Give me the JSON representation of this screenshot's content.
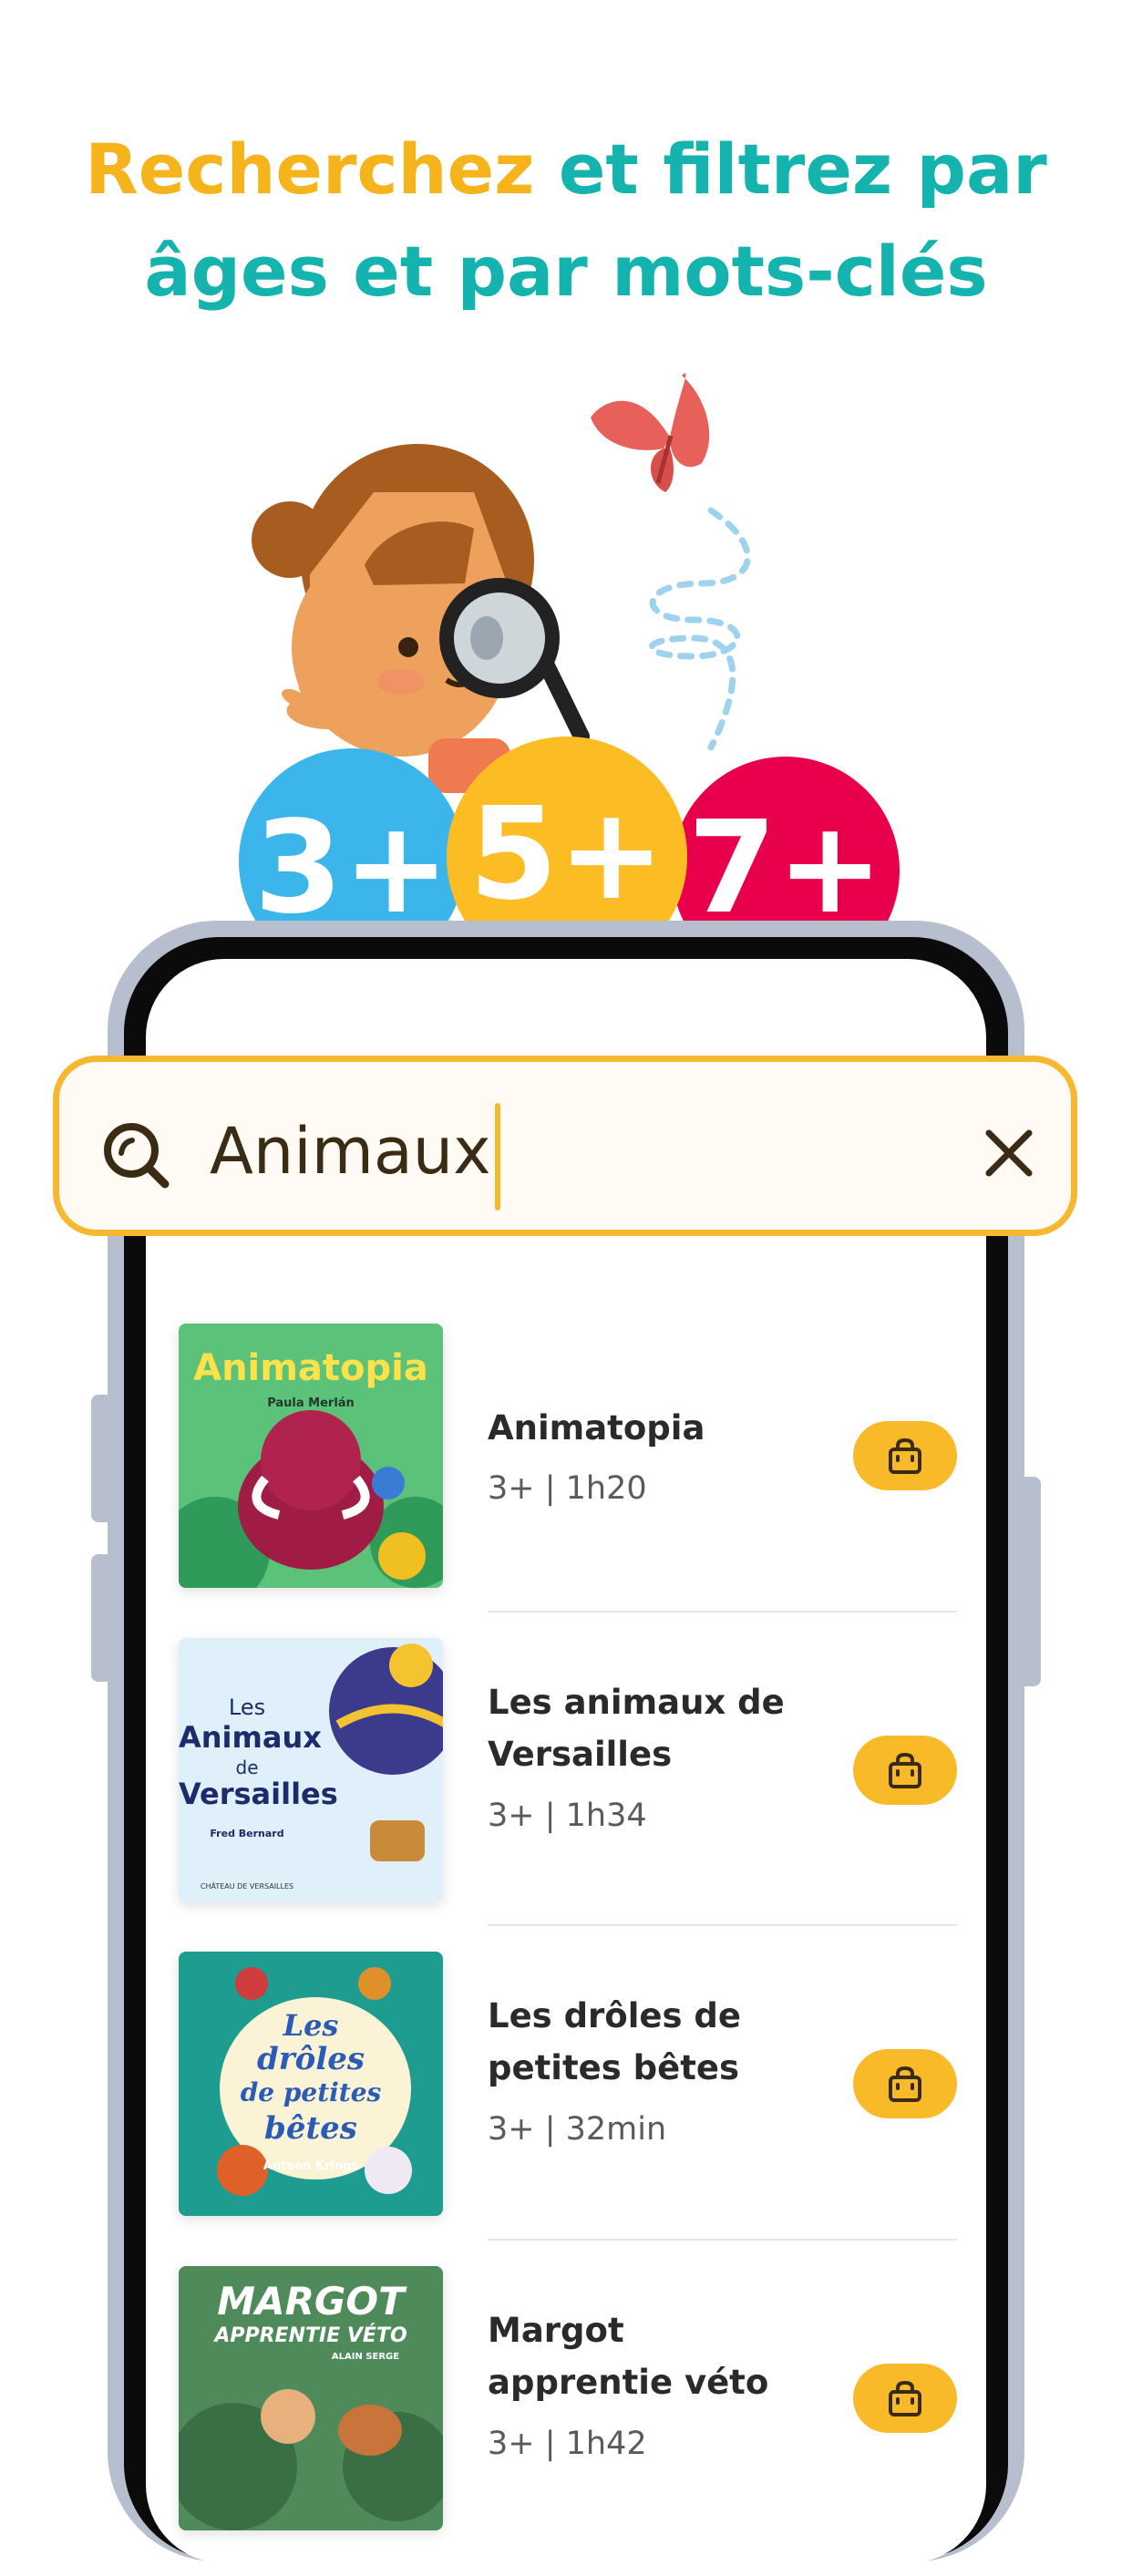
{
  "headline": {
    "part1": "Recherchez",
    "part2": " et filtrez par",
    "line2": "âges et par mots-clés"
  },
  "age_badges": [
    "3+",
    "5+",
    "7+"
  ],
  "search": {
    "query": "Animaux"
  },
  "results": [
    {
      "title": "Animatopia",
      "meta": "3+ | 1h20",
      "cover_title": "Animatopia",
      "cover_author": "Paula Merlán"
    },
    {
      "title": "Les animaux de Versailles",
      "meta": "3+ | 1h34",
      "cover_title_1": "Les",
      "cover_title_2": "Animaux",
      "cover_title_3": "de",
      "cover_title_4": "Versailles",
      "cover_author": "Fred Bernard",
      "cover_footer": "CHÂTEAU DE VERSAILLES"
    },
    {
      "title": "Les drôles de petites bêtes",
      "meta": "3+ | 32min",
      "cover_title_1": "Les",
      "cover_title_2": "drôles",
      "cover_title_3": "de petites",
      "cover_title_4": "bêtes",
      "cover_author": "Antoon Krings"
    },
    {
      "title": "Margot apprentie véto",
      "meta": "3+ | 1h42",
      "cover_title_1": "MARGOT",
      "cover_title_2": "APPRENTIE VÉTO",
      "cover_author": "ALAIN SERGE"
    }
  ],
  "colors": {
    "accent_yellow": "#f6b41c",
    "accent_teal": "#14b3ad",
    "badge_blue": "#3cb6ea",
    "badge_yellow": "#fbbd23",
    "badge_red": "#e9004d",
    "button_yellow": "#f8ba29"
  }
}
